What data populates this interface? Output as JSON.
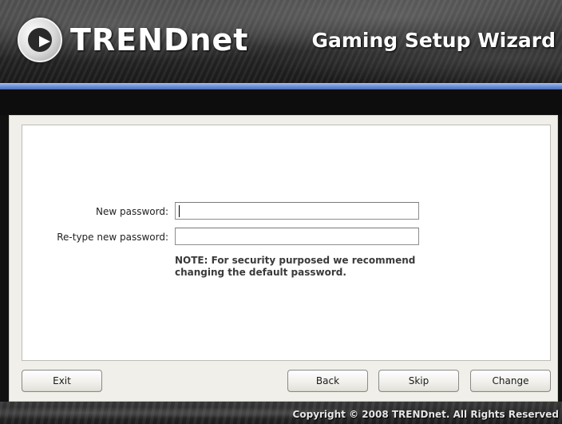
{
  "header": {
    "brand": "TRENDnet",
    "title": "Gaming Setup Wizard",
    "logo_icon": "trendnet-logo-icon"
  },
  "form": {
    "new_password_label": "New password:",
    "new_password_value": "",
    "retype_password_label": "Re-type new password:",
    "retype_password_value": "",
    "note": "NOTE: For security purposed we recommend changing the default password."
  },
  "buttons": {
    "exit": "Exit",
    "back": "Back",
    "skip": "Skip",
    "change": "Change"
  },
  "footer": {
    "copyright": "Copyright © 2008 TRENDnet. All Rights Reserved"
  },
  "colors": {
    "accent_bar": "#6f93d8",
    "header_dark": "#2a2a2a"
  }
}
